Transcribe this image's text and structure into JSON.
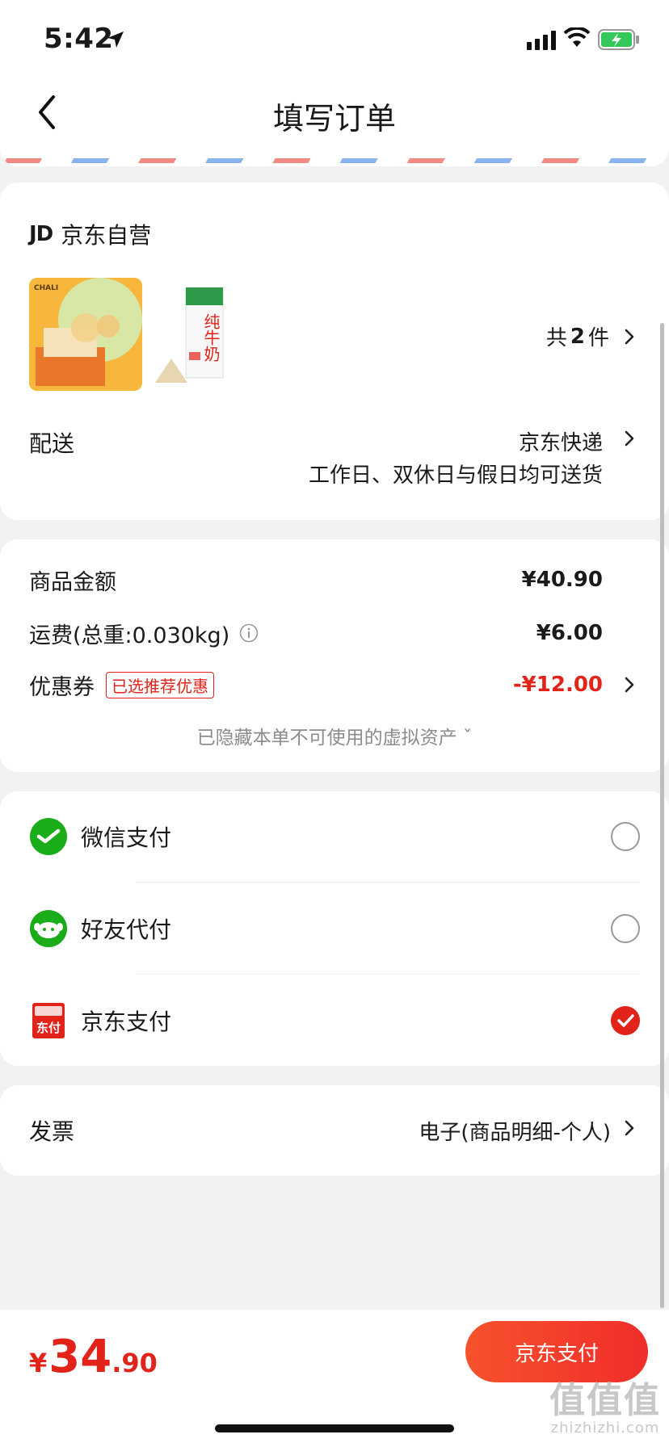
{
  "status_bar": {
    "time": "5:42"
  },
  "nav": {
    "title": "填写订单"
  },
  "shop": {
    "logo": "JD",
    "name": "京东自营"
  },
  "products": {
    "count_prefix": "共",
    "count": "2",
    "count_suffix": "件",
    "item1_brand": "CHALI",
    "item2_label": "纯牛奶"
  },
  "delivery": {
    "label": "配送",
    "method": "京东快递",
    "note": "工作日、双休日与假日均可送货"
  },
  "prices": {
    "goods_label": "商品金额",
    "goods_value": "¥40.90",
    "shipping_label": "运费(总重:0.030kg)",
    "shipping_value": "¥6.00",
    "coupon_label": "优惠券",
    "coupon_badge": "已选推荐优惠",
    "coupon_value": "-¥12.00",
    "hidden_note": "已隐藏本单不可使用的虚拟资产 ˇ"
  },
  "payment": {
    "options": [
      {
        "label": "微信支付",
        "selected": false
      },
      {
        "label": "好友代付",
        "selected": false
      },
      {
        "label": "京东支付",
        "selected": true
      }
    ],
    "jd_icon_text": "东付"
  },
  "invoice": {
    "label": "发票",
    "value": "电子(商品明细-个人)"
  },
  "bottom": {
    "currency": "¥",
    "total_int": "34",
    "total_dec": ".90",
    "pay_button": "京东支付"
  },
  "watermark": {
    "main": "值值值",
    "sub": "zhizhizhi.com"
  },
  "colors": {
    "accent": "#e2231a",
    "wechat_green": "#1aad19",
    "background": "#f2f2f2"
  }
}
